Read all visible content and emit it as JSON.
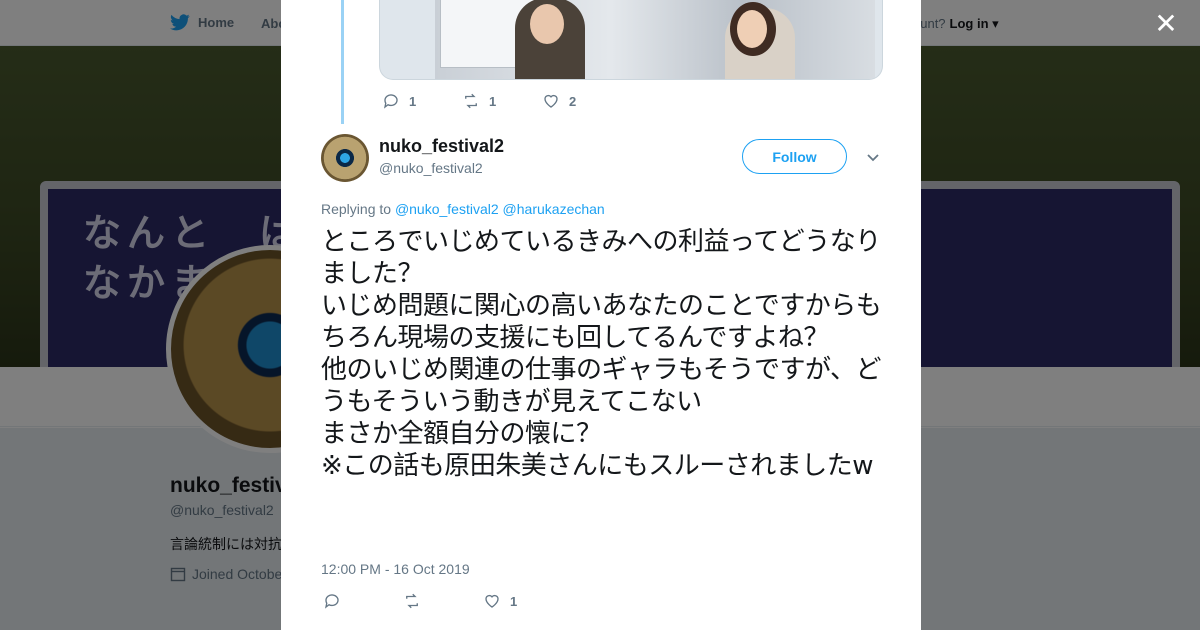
{
  "background_page": {
    "nav": {
      "home_label": "Home",
      "about_label": "Abo",
      "account_question": "ccount?",
      "login_label": "Log in"
    },
    "banner_text": "なんと　は\nなかま",
    "profile": {
      "name": "nuko_festiv",
      "handle": "@nuko_festival2",
      "bio": "言論統制には対抗",
      "joined": "Joined Octobe"
    }
  },
  "modal": {
    "close_icon": "close-icon",
    "previous_tweet": {
      "reply_count": "1",
      "retweet_count": "1",
      "like_count": "2"
    },
    "tweet": {
      "author_name": "nuko_festival2",
      "author_handle": "@nuko_festival2",
      "follow_label": "Follow",
      "replying_to_label": "Replying to",
      "replying_to_users": [
        "@nuko_festival2",
        "@harukazechan"
      ],
      "text": "ところでいじめているきみへの利益ってどうなりました？\nいじめ問題に関心の高いあなたのことですからもちろん現場の支援にも回してるんですよね？\n他のいじめ関連の仕事のギャラもそうですが、どうもそういう動きが見えてこない\nまさか全額自分の懐に？\n※この話も原田朱美さんにもスルーされましたw",
      "timestamp": "12:00 PM - 16 Oct 2019",
      "reply_count": "",
      "retweet_count": "",
      "like_count": "1"
    }
  },
  "colors": {
    "accent": "#1da1f2",
    "thread_line": "#9ad2f5",
    "muted": "#657786"
  }
}
